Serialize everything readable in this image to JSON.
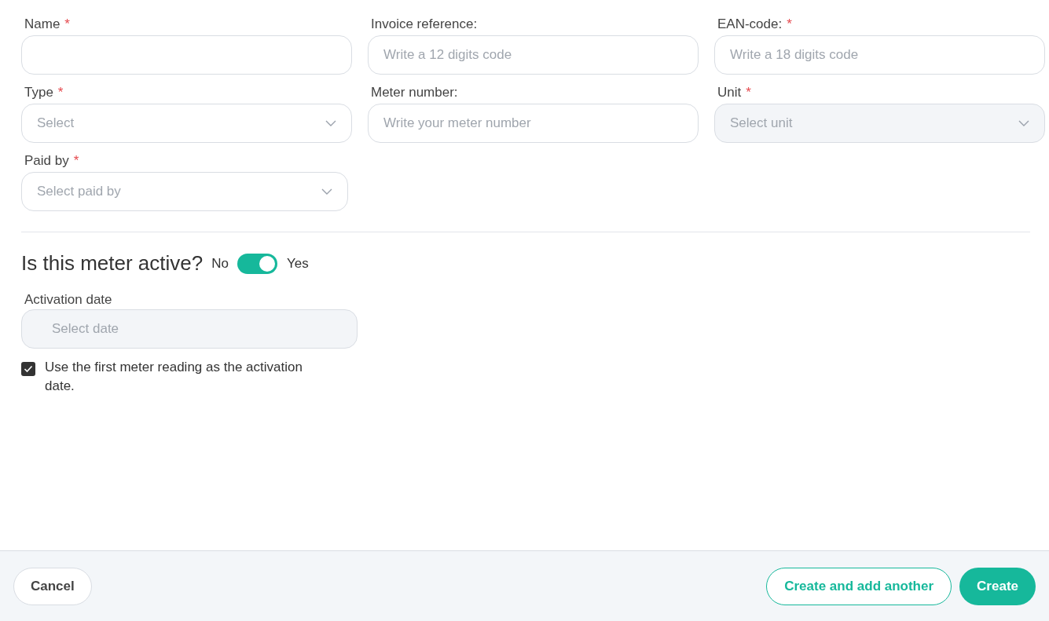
{
  "fields": [
    {
      "label": "Name",
      "required_mark": "*",
      "kind": "text",
      "disabled": false
    },
    {
      "label": "Invoice reference:",
      "kind": "text",
      "placeholder": "Write a 12 digits code",
      "disabled": false
    },
    {
      "label": "EAN-code:",
      "required_mark": "*",
      "kind": "text",
      "placeholder": "Write a 18 digits code",
      "disabled": false
    },
    {
      "label": "Type",
      "required_mark": "*",
      "kind": "select",
      "placeholder": "Select",
      "disabled": false
    },
    {
      "label": "Meter number:",
      "kind": "text",
      "placeholder": "Write your meter number",
      "disabled": false
    },
    {
      "label": "Unit",
      "required_mark": "*",
      "kind": "select",
      "placeholder": "Select unit",
      "disabled": true
    },
    {
      "label": "Paid by",
      "required_mark": "*",
      "kind": "select",
      "placeholder": "Select paid by",
      "disabled": false
    }
  ],
  "active": {
    "question": "Is this meter active?",
    "off_label": "No",
    "on_label": "Yes",
    "on": true
  },
  "activation_date": {
    "label": "Activation date",
    "placeholder": "Select date",
    "disabled": true
  },
  "first_reading": {
    "label": "Use the first meter reading as the activation date.",
    "checked": true
  },
  "buttons": [
    {
      "label": "Cancel",
      "kind": "secondary"
    },
    {
      "label": "Create and add another",
      "kind": "outline"
    },
    {
      "label": "Create",
      "kind": "primary"
    }
  ]
}
